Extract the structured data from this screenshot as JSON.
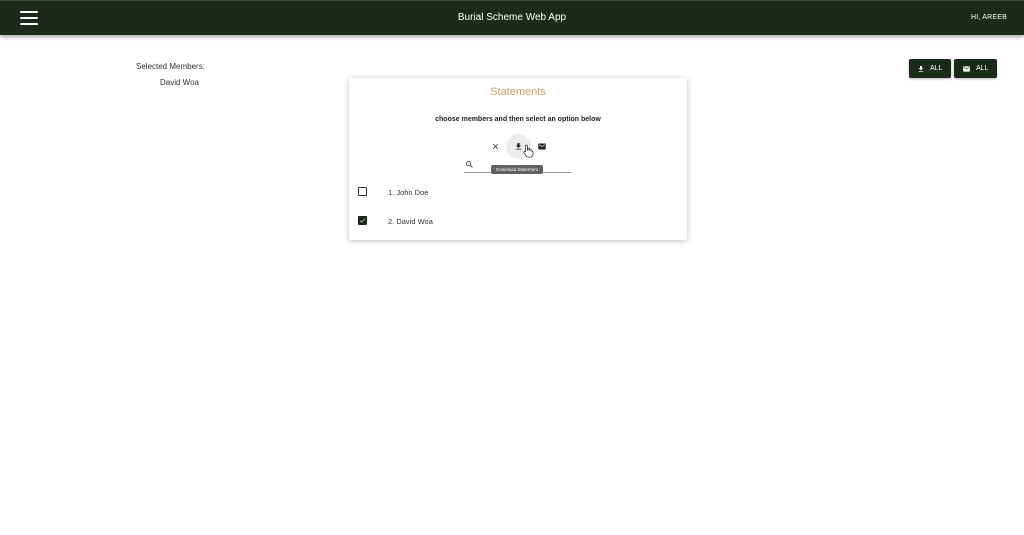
{
  "appbar": {
    "title": "Burial Scheme Web App",
    "greeting": "HI, AREEB",
    "background": "#1c2a1c"
  },
  "selected": {
    "label": "Selected Members:",
    "members": [
      "David Woa"
    ]
  },
  "actions": {
    "download_all_label": "ALL",
    "email_all_label": "ALL",
    "download_icon": "download-icon",
    "email_icon": "email-icon"
  },
  "statements": {
    "title": "Statements",
    "title_color": "#c4a06a",
    "instruction": "choose members and then select an option below",
    "tooltip": "Download Statement",
    "search_placeholder": "",
    "search_value": "",
    "members": [
      {
        "label": "1. John Doe",
        "checked": false
      },
      {
        "label": "2. David Woa",
        "checked": true
      }
    ]
  }
}
